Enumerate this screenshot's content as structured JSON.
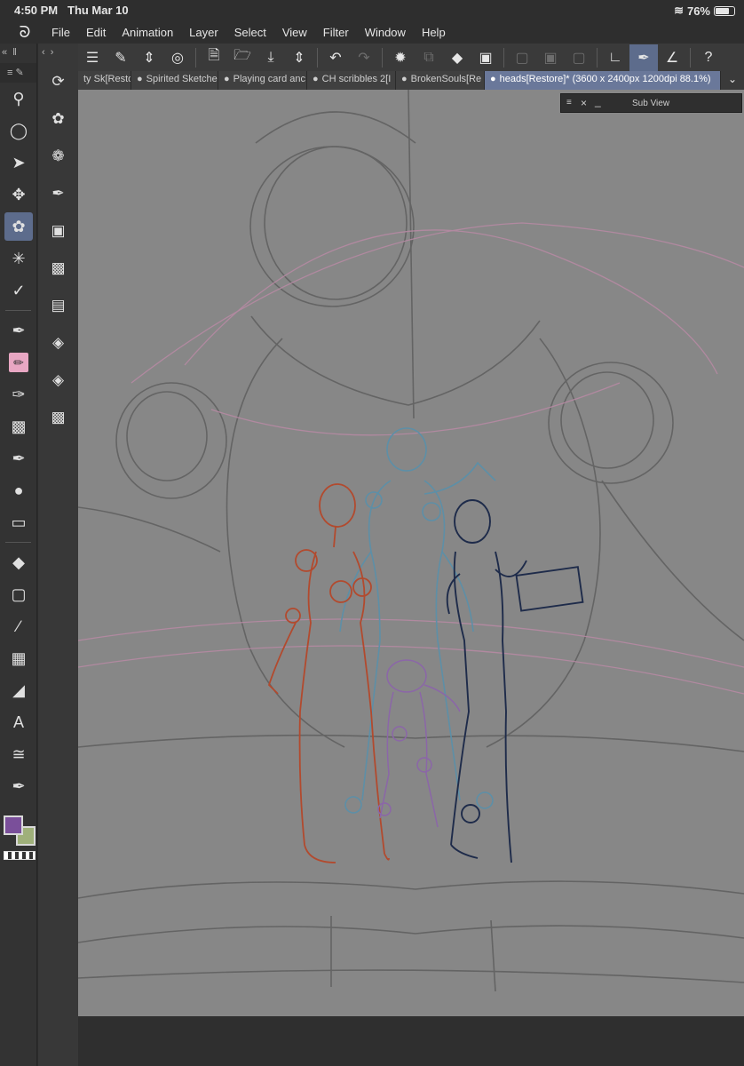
{
  "status": {
    "time": "4:50 PM",
    "date": "Thu Mar 10",
    "battery": "76%"
  },
  "menu": {
    "items": [
      "File",
      "Edit",
      "Animation",
      "Layer",
      "Select",
      "View",
      "Filter",
      "Window",
      "Help"
    ]
  },
  "tabs": [
    {
      "label": "ty Sk[Resto"
    },
    {
      "label": "Spirited Sketche"
    },
    {
      "label": "Playing card anc"
    },
    {
      "label": "CH scribbles 2[I"
    },
    {
      "label": "BrokenSouls[Re"
    },
    {
      "label": "heads[Restore]* (3600 x 2400px 1200dpi 88.1%)"
    }
  ],
  "subview": {
    "title": "Sub View"
  },
  "colors": {
    "main": "#7a4f9a",
    "sub": "#9fb07a",
    "canvas": "#878787",
    "active": "#5d6c8c"
  },
  "tools": [
    "magnifier-icon",
    "move-view-icon",
    "object-icon",
    "move-layer-icon",
    "lasso-icon",
    "magic-wand-icon",
    "eyedropper-icon",
    "pen-icon",
    "pencil-icon",
    "brush-icon",
    "airbrush-icon",
    "decoration-icon",
    "blend-icon",
    "eraser-icon",
    "fill-icon",
    "gradient-icon",
    "line-icon",
    "frame-icon",
    "ruler-icon",
    "text-icon",
    "balloon-icon",
    "correct-line-icon"
  ],
  "subtools": [
    "rotate-view-icon",
    "lasso-select-icon",
    "selection-pen-icon",
    "shrink-select-icon",
    "frame-border-icon",
    "pattern-icon",
    "film-icon",
    "layer-stack-icon",
    "layers-icon",
    "texture-icon"
  ]
}
